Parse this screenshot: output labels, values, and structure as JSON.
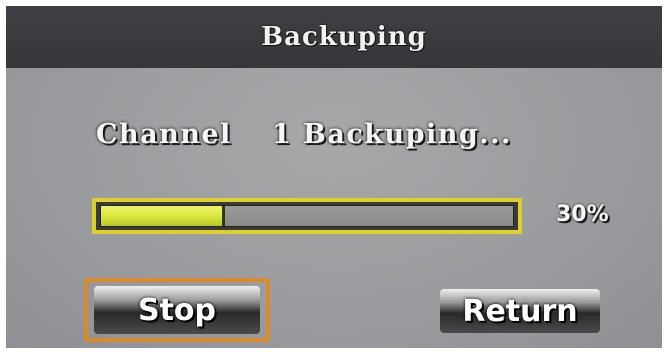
{
  "dialog": {
    "title": "Backuping"
  },
  "status": {
    "label": "Channel",
    "message": "1 Backuping..."
  },
  "progress": {
    "percent": 30,
    "text": "30%",
    "fill_color": "#dfe84a",
    "border_color": "#e0cf2a"
  },
  "buttons": {
    "stop_label": "Stop",
    "return_label": "Return",
    "focus_color": "#d98a2a"
  }
}
